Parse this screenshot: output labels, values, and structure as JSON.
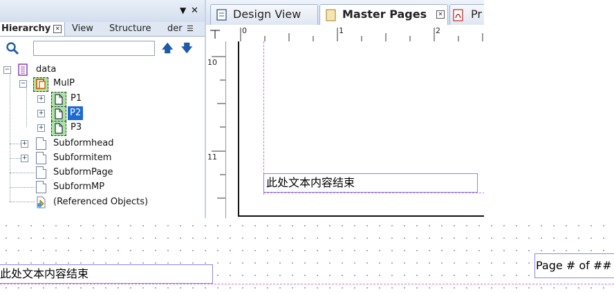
{
  "left_panel": {
    "tabs": [
      {
        "label": "Hierarchy"
      },
      {
        "label": "View"
      },
      {
        "label": "Structure"
      },
      {
        "label": "der"
      }
    ],
    "search": {
      "value": "",
      "placeholder": ""
    },
    "tree": [
      {
        "label": "data"
      },
      {
        "label": "MulP"
      },
      {
        "label": "P1"
      },
      {
        "label": "P2"
      },
      {
        "label": "P3"
      },
      {
        "label": "Subformhead"
      },
      {
        "label": "Subformitem"
      },
      {
        "label": "SubformPage"
      },
      {
        "label": "SubformMP"
      },
      {
        "label": "(Referenced Objects)"
      }
    ]
  },
  "doc_tabs": [
    {
      "label": "Design View"
    },
    {
      "label": "Master Pages"
    },
    {
      "label": "Pr"
    }
  ],
  "ruler": {
    "h_labels": [
      "0",
      "1",
      "2"
    ],
    "v_labels": [
      "10",
      "11"
    ]
  },
  "canvas": {
    "textbox_inner": "此处文本内容结束",
    "textbox_bottom_left": "此处文本内容结束",
    "page_number": "Page # of ##"
  },
  "colors": {
    "selection": "#1c6bd2",
    "textbox_border": "#8a86e0",
    "guide_line": "#d070d0"
  }
}
